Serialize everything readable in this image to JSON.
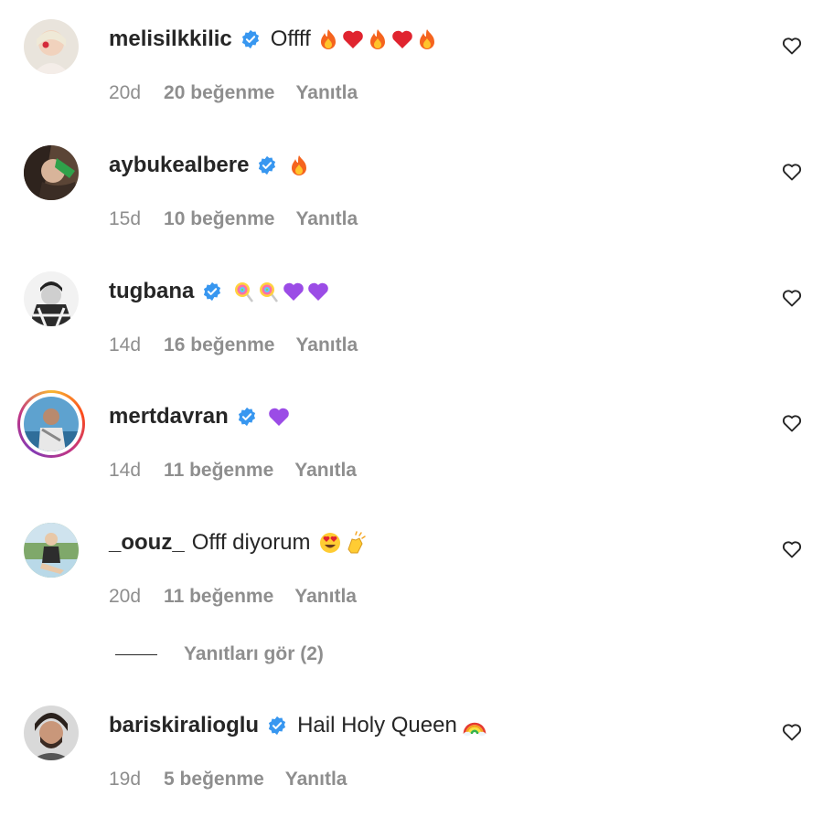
{
  "comments": [
    {
      "username": "melisilkkilic",
      "text": "Offff",
      "emojis": [
        "fire",
        "heart",
        "fire",
        "heart",
        "fire"
      ],
      "time": "20d",
      "likes": "20 beğenme",
      "reply": "Yanıtla"
    },
    {
      "username": "aybukealbere",
      "text": "",
      "emojis": [
        "fire"
      ],
      "time": "15d",
      "likes": "10 beğenme",
      "reply": "Yanıtla"
    },
    {
      "username": "tugbana",
      "text": "",
      "emojis": [
        "lollipop",
        "lollipop",
        "purple-heart",
        "purple-heart"
      ],
      "time": "14d",
      "likes": "16 beğenme",
      "reply": "Yanıtla"
    },
    {
      "username": "mertdavran",
      "text": "",
      "emojis": [
        "purple-heart"
      ],
      "time": "14d",
      "likes": "11 beğenme",
      "reply": "Yanıtla"
    },
    {
      "username": "_oouz_",
      "text": "Offf diyorum",
      "emojis": [
        "heart-eyes",
        "clap"
      ],
      "time": "20d",
      "likes": "11 beğenme",
      "reply": "Yanıtla"
    },
    {
      "username": "bariskiralioglu",
      "text": "Hail Holy Queen",
      "emojis": [
        "rainbow"
      ],
      "time": "19d",
      "likes": "5 beğenme",
      "reply": "Yanıtla"
    }
  ],
  "view_replies": "Yanıtları gör (2)",
  "colors": {
    "text": "#262626",
    "secondary": "#8e8e8e",
    "verified": "#3897f0"
  }
}
